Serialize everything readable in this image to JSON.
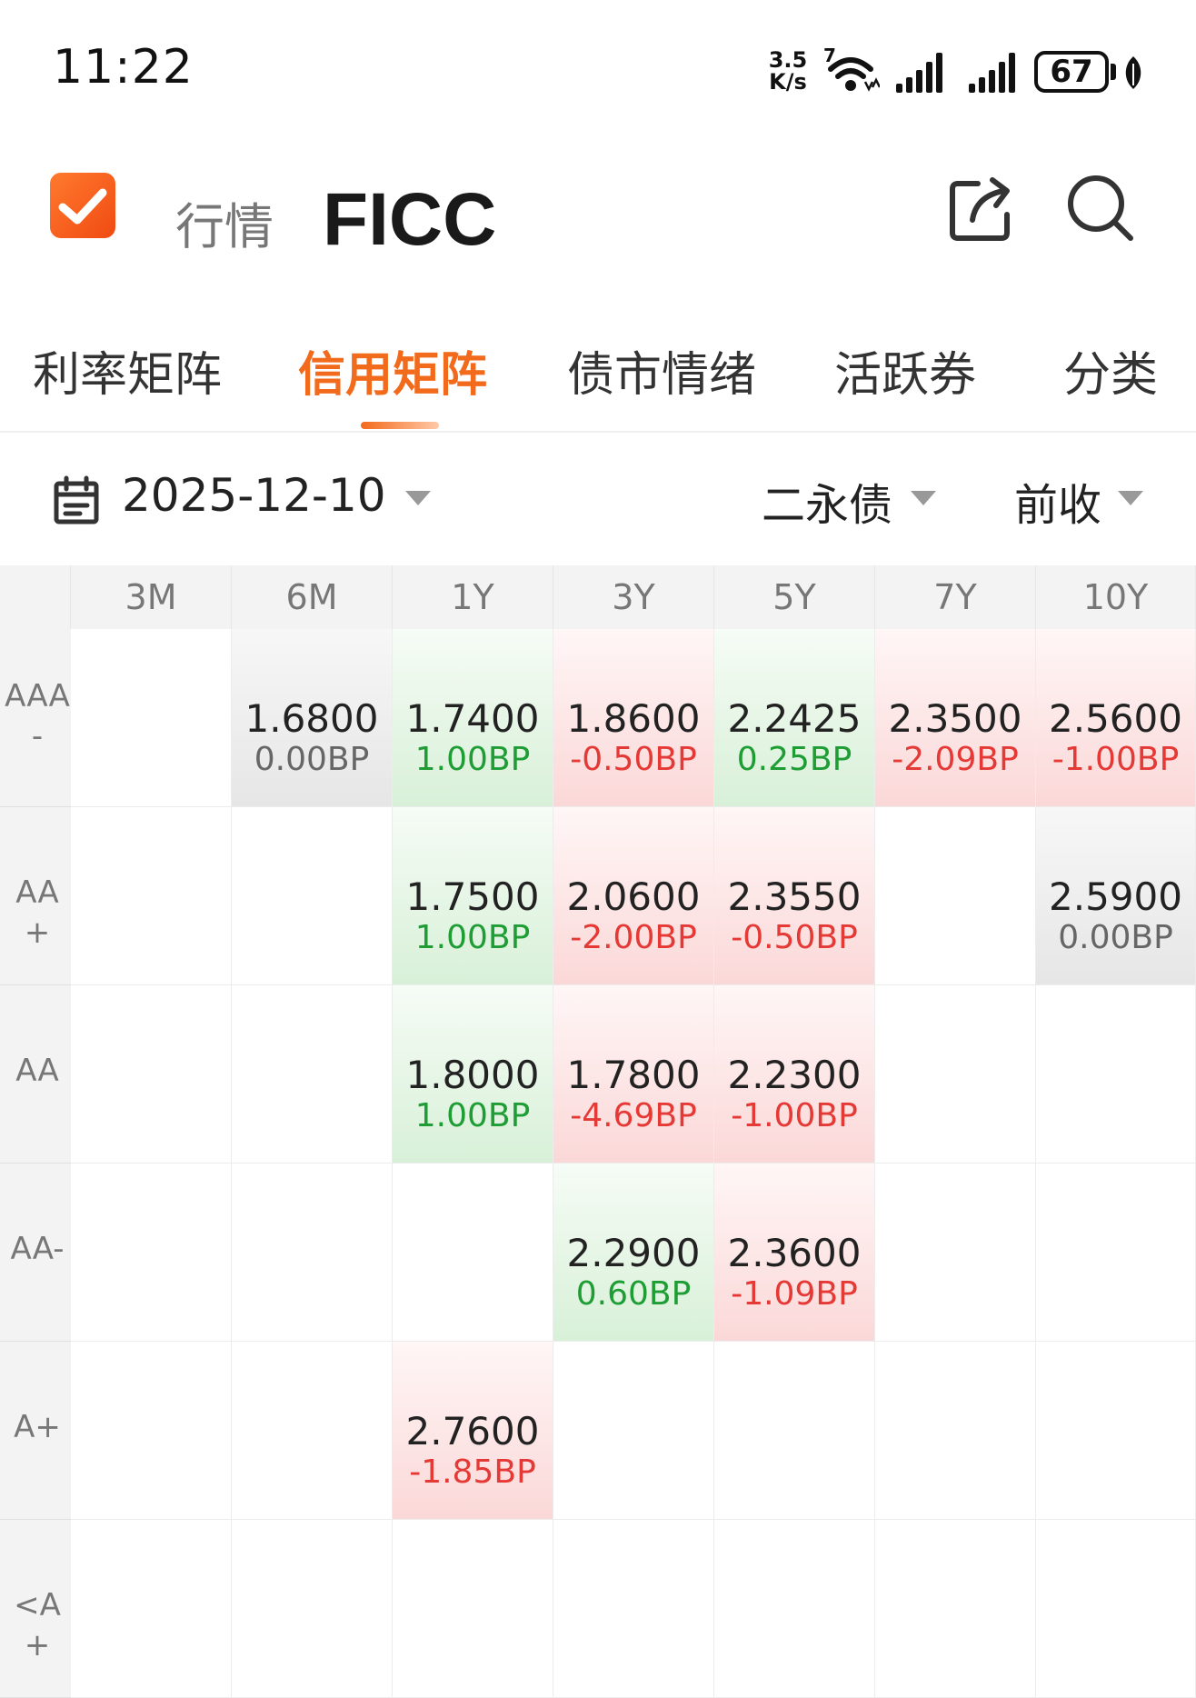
{
  "status_bar": {
    "time": "11:22",
    "speed_value": "3.5",
    "speed_unit": "K/s",
    "wifi_badge": "7",
    "battery": "67"
  },
  "header": {
    "logo_icon": "check-logo-icon",
    "section": "行情",
    "title": "FICC",
    "actions": [
      "share-icon",
      "search-icon"
    ]
  },
  "tabs": [
    {
      "label": "利率矩阵",
      "active": false
    },
    {
      "label": "信用矩阵",
      "active": true
    },
    {
      "label": "债市情绪",
      "active": false
    },
    {
      "label": "活跃券",
      "active": false
    },
    {
      "label": "分类",
      "active": false
    }
  ],
  "filters": {
    "date": "2025-12-10",
    "bond_type": "二永债",
    "price_basis": "前收"
  },
  "matrix": {
    "columns": [
      "3M",
      "6M",
      "1Y",
      "3Y",
      "5Y",
      "7Y",
      "10Y"
    ],
    "rows": [
      {
        "rating": "AAA-",
        "cells": [
          null,
          {
            "value": "1.6800",
            "change": "0.00BP",
            "trend": "flat"
          },
          {
            "value": "1.7400",
            "change": "1.00BP",
            "trend": "down"
          },
          {
            "value": "1.8600",
            "change": "-0.50BP",
            "trend": "up"
          },
          {
            "value": "2.2425",
            "change": "0.25BP",
            "trend": "down"
          },
          {
            "value": "2.3500",
            "change": "-2.09BP",
            "trend": "up"
          },
          {
            "value": "2.5600",
            "change": "-1.00BP",
            "trend": "up"
          }
        ]
      },
      {
        "rating": "AA+",
        "cells": [
          null,
          null,
          {
            "value": "1.7500",
            "change": "1.00BP",
            "trend": "down"
          },
          {
            "value": "2.0600",
            "change": "-2.00BP",
            "trend": "up"
          },
          {
            "value": "2.3550",
            "change": "-0.50BP",
            "trend": "up"
          },
          null,
          {
            "value": "2.5900",
            "change": "0.00BP",
            "trend": "flat"
          }
        ]
      },
      {
        "rating": "AA",
        "cells": [
          null,
          null,
          {
            "value": "1.8000",
            "change": "1.00BP",
            "trend": "down"
          },
          {
            "value": "1.7800",
            "change": "-4.69BP",
            "trend": "up"
          },
          {
            "value": "2.2300",
            "change": "-1.00BP",
            "trend": "up"
          },
          null,
          null
        ]
      },
      {
        "rating": "AA-",
        "cells": [
          null,
          null,
          null,
          {
            "value": "2.2900",
            "change": "0.60BP",
            "trend": "down"
          },
          {
            "value": "2.3600",
            "change": "-1.09BP",
            "trend": "up"
          },
          null,
          null
        ]
      },
      {
        "rating": "A+",
        "cells": [
          null,
          null,
          {
            "value": "2.7600",
            "change": "-1.85BP",
            "trend": "up"
          },
          null,
          null,
          null,
          null
        ]
      },
      {
        "rating": "<A+",
        "cells": [
          null,
          null,
          null,
          null,
          null,
          null,
          null
        ]
      }
    ]
  }
}
